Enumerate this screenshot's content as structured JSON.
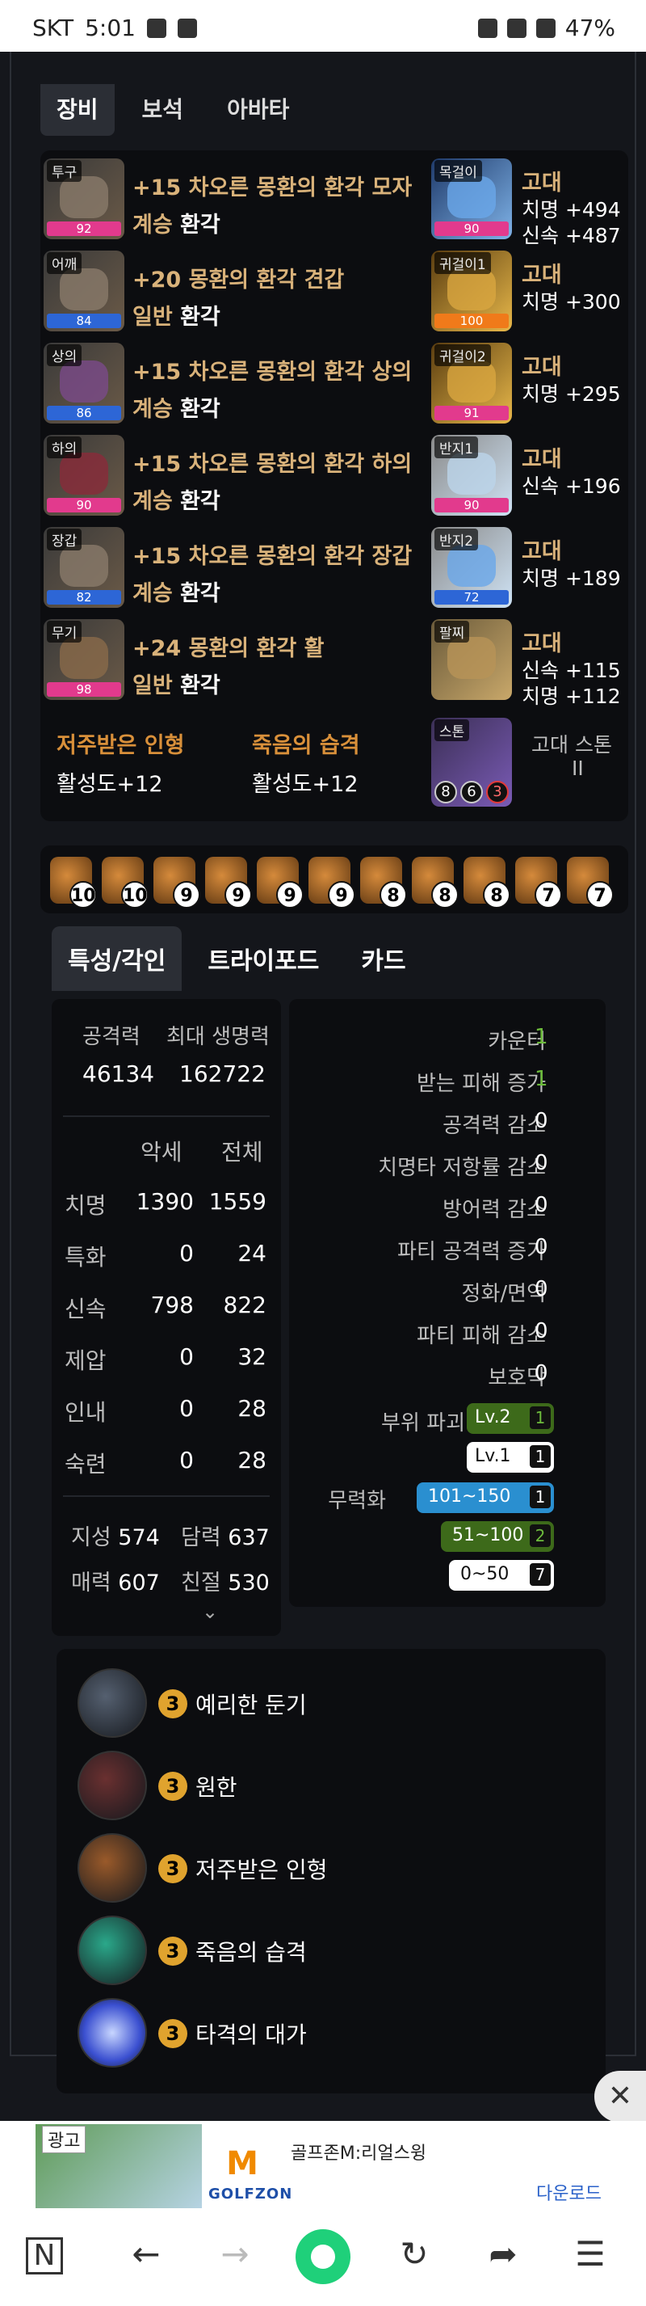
{
  "statusbar": {
    "carrier": "SKT",
    "time": "5:01",
    "battery": "47%"
  },
  "top_tabs": [
    "장비",
    "보석",
    "아바타"
  ],
  "equipment": [
    {
      "slot": "투구",
      "quality": "92",
      "bar": "pink",
      "name": "+15 차오른 몽환의 환각 모자",
      "k1": "계승",
      "k2": "환각"
    },
    {
      "slot": "어깨",
      "quality": "84",
      "bar": "blue",
      "name": "+20 몽환의 환각 견갑",
      "k1": "일반",
      "k2": "환각"
    },
    {
      "slot": "상의",
      "quality": "86",
      "bar": "blue",
      "name": "+15 차오른 몽환의 환각 상의",
      "k1": "계승",
      "k2": "환각"
    },
    {
      "slot": "하의",
      "quality": "90",
      "bar": "pink",
      "name": "+15 차오른 몽환의 환각 하의",
      "k1": "계승",
      "k2": "환각"
    },
    {
      "slot": "장갑",
      "quality": "82",
      "bar": "blue",
      "name": "+15 차오른 몽환의 환각 장갑",
      "k1": "계승",
      "k2": "환각"
    },
    {
      "slot": "무기",
      "quality": "98",
      "bar": "pink",
      "name": "+24 몽환의 환각 활",
      "k1": "일반",
      "k2": "환각"
    }
  ],
  "accessories": [
    {
      "slot": "목걸이",
      "quality": "90",
      "bar": "pink",
      "grade": "고대",
      "s1": "치명 +494",
      "s2": "신속 +487"
    },
    {
      "slot": "귀걸이1",
      "quality": "100",
      "bar": "orange",
      "grade": "고대",
      "s1": "치명 +300",
      "s2": ""
    },
    {
      "slot": "귀걸이2",
      "quality": "91",
      "bar": "pink",
      "grade": "고대",
      "s1": "치명 +295",
      "s2": ""
    },
    {
      "slot": "반지1",
      "quality": "90",
      "bar": "pink",
      "grade": "고대",
      "s1": "신속 +196",
      "s2": ""
    },
    {
      "slot": "반지2",
      "quality": "72",
      "bar": "blue",
      "grade": "고대",
      "s1": "치명 +189",
      "s2": ""
    },
    {
      "slot": "팔찌",
      "quality": "",
      "bar": "",
      "grade": "고대",
      "s1": "신속 +115",
      "s2": "치명 +112"
    }
  ],
  "engravings": [
    {
      "name": "저주받은 인형",
      "value": "활성도+12"
    },
    {
      "name": "죽음의 습격",
      "value": "활성도+12"
    }
  ],
  "stone": {
    "tag": "스톤",
    "nums": [
      "8",
      "6",
      "3"
    ],
    "label": "고대 스톤",
    "label2": "II"
  },
  "gems": [
    "10",
    "10",
    "9",
    "9",
    "9",
    "9",
    "8",
    "8",
    "8",
    "7",
    "7"
  ],
  "tabs2": [
    "특성/각인",
    "트라이포드",
    "카드"
  ],
  "basic": {
    "atk_label": "공격력",
    "hp_label": "최대 생명력",
    "atk": "46134",
    "hp": "162722"
  },
  "stat_headers": {
    "acc": "악세",
    "total": "전체"
  },
  "stats": [
    {
      "name": "치명",
      "acc": "1390",
      "total": "1559"
    },
    {
      "name": "특화",
      "acc": "0",
      "total": "24"
    },
    {
      "name": "신속",
      "acc": "798",
      "total": "822"
    },
    {
      "name": "제압",
      "acc": "0",
      "total": "32"
    },
    {
      "name": "인내",
      "acc": "0",
      "total": "28"
    },
    {
      "name": "숙련",
      "acc": "0",
      "total": "28"
    }
  ],
  "tendencies": [
    {
      "label": "지성",
      "value": "574"
    },
    {
      "label": "담력",
      "value": "637"
    },
    {
      "label": "매력",
      "value": "607"
    },
    {
      "label": "친절",
      "value": "530"
    }
  ],
  "effects": [
    {
      "label": "카운터",
      "value": "1",
      "green": true
    },
    {
      "label": "받는 피해 증가",
      "value": "1",
      "green": true
    },
    {
      "label": "공격력 감소",
      "value": "0",
      "green": false
    },
    {
      "label": "치명타 저항률 감소",
      "value": "0",
      "green": false
    },
    {
      "label": "방어력 감소",
      "value": "0",
      "green": false
    },
    {
      "label": "파티 공격력 증가",
      "value": "0",
      "green": false
    },
    {
      "label": "정화/면역",
      "value": "0",
      "green": false
    },
    {
      "label": "파티 피해 감소",
      "value": "0",
      "green": false
    },
    {
      "label": "보호막",
      "value": "0",
      "green": false
    }
  ],
  "part_break": {
    "label": "부위 파괴",
    "pills": [
      {
        "text": "Lv.2",
        "count": "1"
      },
      {
        "text": "Lv.1",
        "count": "1"
      }
    ]
  },
  "neutralize": {
    "label": "무력화",
    "pills": [
      {
        "text": "101~150",
        "count": "1"
      },
      {
        "text": "51~100",
        "count": "2"
      },
      {
        "text": "0~50",
        "count": "7"
      }
    ]
  },
  "cards": [
    {
      "level": "3",
      "name": "예리한 둔기"
    },
    {
      "level": "3",
      "name": "원한"
    },
    {
      "level": "3",
      "name": "저주받은 인형"
    },
    {
      "level": "3",
      "name": "죽음의 습격"
    },
    {
      "level": "3",
      "name": "타격의 대가"
    }
  ],
  "ad": {
    "label": "광고",
    "brand": "GOLFZON",
    "title": "골프존M:리얼스윙",
    "download": "다운로드"
  }
}
